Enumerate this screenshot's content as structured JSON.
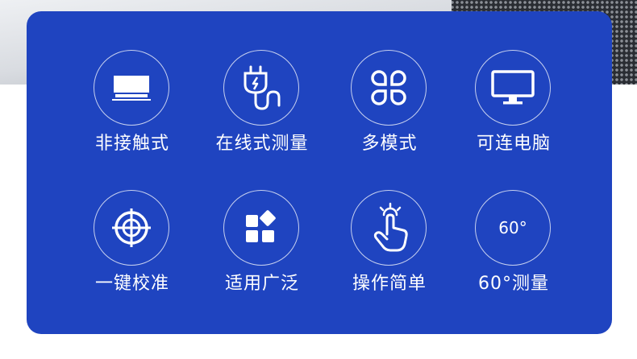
{
  "features": [
    {
      "label": "非接触式",
      "icon": "monitor-bracket-icon"
    },
    {
      "label": "在线式测量",
      "icon": "plug-cable-icon"
    },
    {
      "label": "多模式",
      "icon": "four-petal-icon"
    },
    {
      "label": "可连电脑",
      "icon": "computer-monitor-icon"
    },
    {
      "label": "一键校准",
      "icon": "crosshair-target-icon"
    },
    {
      "label": "适用广泛",
      "icon": "app-grid-icon"
    },
    {
      "label": "操作简单",
      "icon": "tap-hand-icon"
    },
    {
      "label": "60°测量",
      "icon": "angle-text-icon",
      "icon_text": "60°"
    }
  ],
  "colors": {
    "panel": "#1f44c0",
    "foreground": "#ffffff"
  }
}
